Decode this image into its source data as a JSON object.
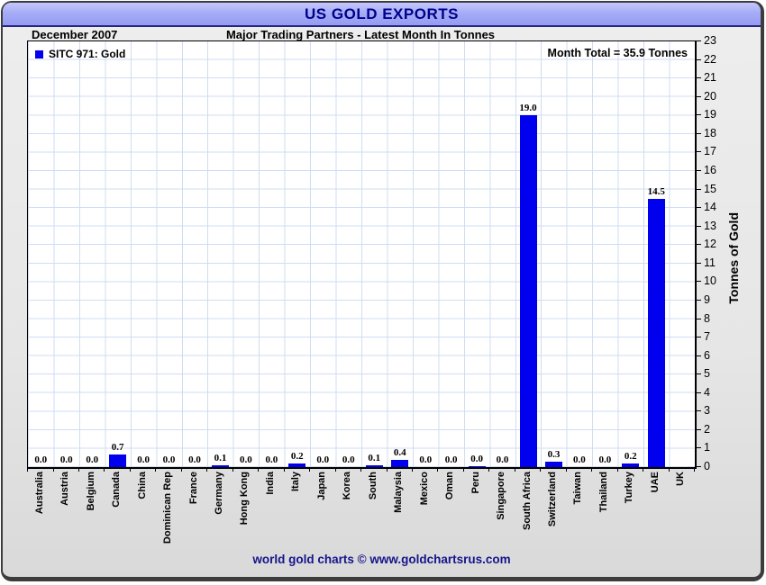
{
  "chart_data": {
    "type": "bar",
    "title": "US GOLD EXPORTS",
    "date_label": "December 2007",
    "subtitle": "Major Trading Partners - Latest Month In Tonnes",
    "legend_label": "SITC 971: Gold",
    "month_total": "Month Total = 35.9 Tonnes",
    "ylabel": "Tonnes of Gold",
    "ylim": [
      0,
      23
    ],
    "yticks": [
      0,
      1,
      2,
      3,
      4,
      5,
      6,
      7,
      8,
      9,
      10,
      11,
      12,
      13,
      14,
      15,
      16,
      17,
      18,
      19,
      20,
      21,
      22,
      23
    ],
    "grid": true,
    "legend_position": "top-left",
    "bar_color": "#0000ee",
    "categories": [
      "Australia",
      "Austria",
      "Belgium",
      "Canada",
      "China",
      "Dominican Rep",
      "France",
      "Germany",
      "Hong Kong",
      "India",
      "Italy",
      "Japan",
      "Korea",
      "South",
      "Malaysia",
      "Mexico",
      "Oman",
      "Peru",
      "Singapore",
      "South Africa",
      "Switzerland",
      "Taiwan",
      "Thailand",
      "Turkey",
      "UAE",
      "UK"
    ],
    "values": [
      0,
      0,
      0,
      0.7,
      0,
      0,
      0,
      0.1,
      0,
      0,
      0.2,
      0,
      0,
      0.1,
      0.4,
      0,
      0,
      0.05,
      0,
      19.0,
      0.3,
      0,
      0,
      0.2,
      14.5,
      0
    ],
    "value_labels": [
      "0.0",
      "0.0",
      "0.0",
      "0.7",
      "0.0",
      "0.0",
      "0.0",
      "0.1",
      "0.0",
      "0.0",
      "0.2",
      "0.0",
      "0.0",
      "0.1",
      "0.4",
      "0.0",
      "0.0",
      "0.0",
      "0.0",
      "19.0",
      "0.3",
      "0.0",
      "0.0",
      "0.2",
      "14.5",
      ""
    ],
    "footer": "world gold charts © www.goldchartsrus.com"
  }
}
